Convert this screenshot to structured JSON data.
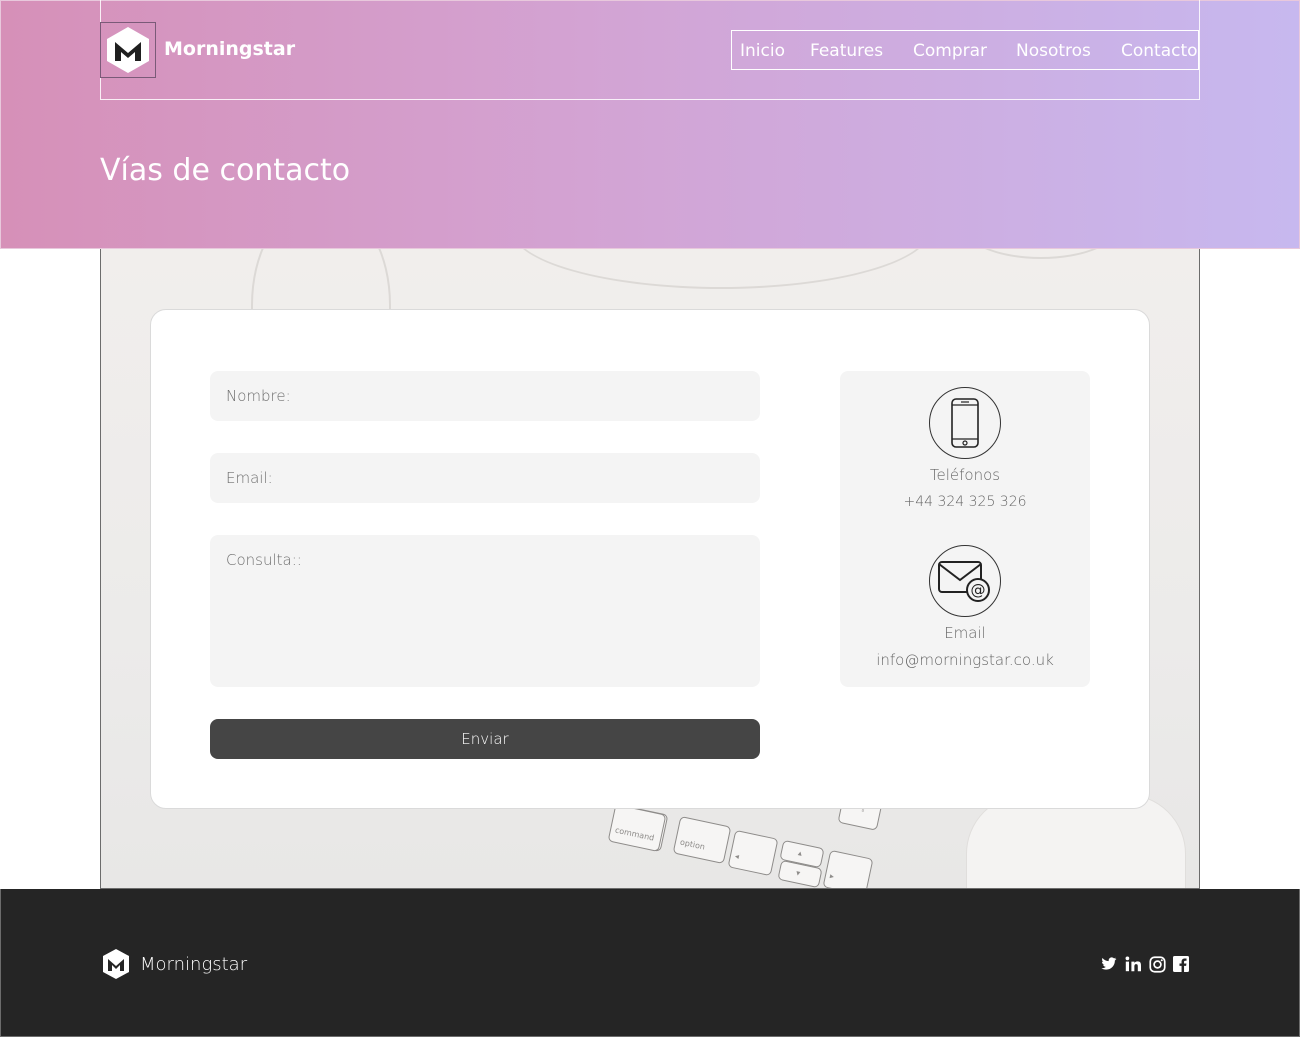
{
  "header": {
    "brand": "Morningstar",
    "nav": [
      "Inicio",
      "Features",
      "Comprar",
      "Nosotros",
      "Contacto"
    ],
    "page_title": "Vías de contacto"
  },
  "form": {
    "name_placeholder": "Nombre:",
    "email_placeholder": "Email:",
    "query_placeholder": "Consulta::",
    "submit_label": "Enviar"
  },
  "info": {
    "phone_label": "Teléfonos",
    "phone_value": "+44 324 325 326",
    "email_label": "Email",
    "email_value": "info@morningstar.co.uk"
  },
  "background": {
    "keys": [
      "⌘",
      "command",
      "alt",
      "option",
      "◂",
      "▴",
      "▾",
      "▸",
      "⇧"
    ]
  },
  "footer": {
    "brand": "Morningstar",
    "social": [
      "twitter-icon",
      "linkedin-icon",
      "instagram-icon",
      "facebook-icon"
    ]
  },
  "colors": {
    "gradient_start": "#d690b8",
    "gradient_end": "#c7b8ef",
    "footer_bg": "#252525",
    "button_bg": "#454545"
  }
}
